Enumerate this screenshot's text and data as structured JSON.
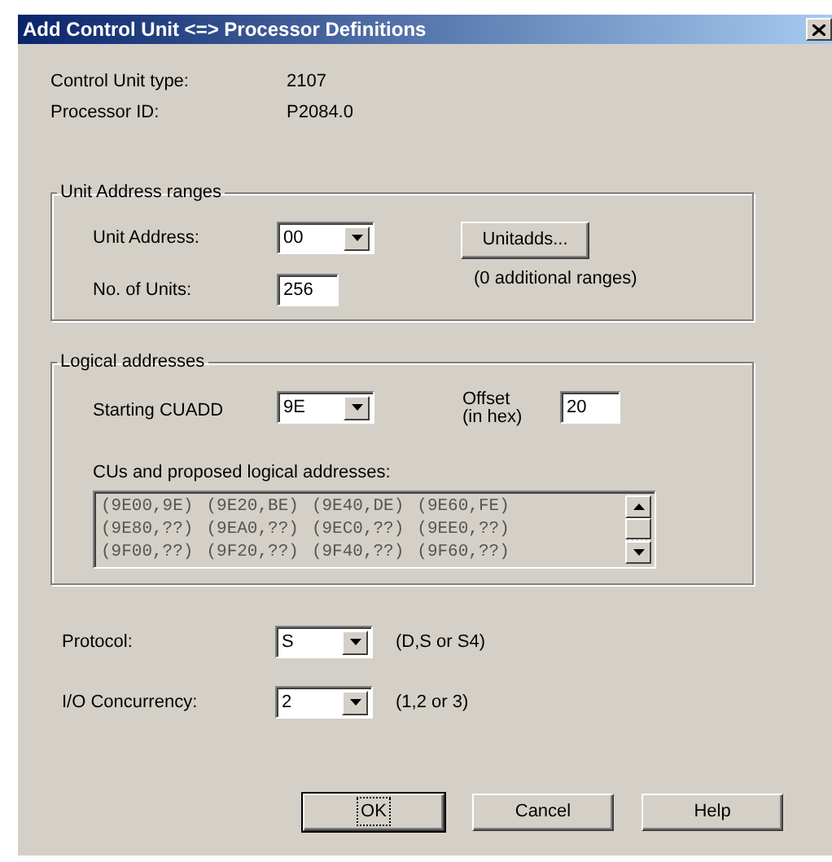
{
  "window": {
    "title": "Add Control Unit <=> Processor Definitions"
  },
  "info": [
    {
      "label": "Control Unit type:",
      "value": "2107"
    },
    {
      "label": "Processor ID:",
      "value": "P2084.0"
    }
  ],
  "unit_address_ranges": {
    "title": "Unit Address ranges",
    "unit_address": {
      "label": "Unit Address:",
      "value": "00"
    },
    "no_of_units": {
      "label": "No. of Units:",
      "value": "256"
    },
    "button": "Unitadds...",
    "note": "(0 additional ranges)"
  },
  "logical_addresses": {
    "title": "Logical addresses",
    "starting_cuadd": {
      "label": "Starting CUADD",
      "value": "9E"
    },
    "offset": {
      "label": "Offset",
      "sublabel": "(in hex)",
      "value": "20"
    },
    "list_label": "CUs and proposed logical addresses:",
    "list_rows": [
      [
        "(9E00,9E)",
        "(9E20,BE)",
        "(9E40,DE)",
        "(9E60,FE)"
      ],
      [
        "(9E80,??)",
        "(9EA0,??)",
        "(9EC0,??)",
        "(9EE0,??)"
      ],
      [
        "(9F00,??)",
        "(9F20,??)",
        "(9F40,??)",
        "(9F60,??)"
      ]
    ]
  },
  "protocol": {
    "label": "Protocol:",
    "value": "S",
    "hint": "(D,S or S4)"
  },
  "io_concurrency": {
    "label": "I/O Concurrency:",
    "value": "2",
    "hint": "(1,2 or 3)"
  },
  "buttons": [
    {
      "label": "OK",
      "default": true
    },
    {
      "label": "Cancel",
      "default": false
    },
    {
      "label": "Help",
      "default": false
    }
  ]
}
